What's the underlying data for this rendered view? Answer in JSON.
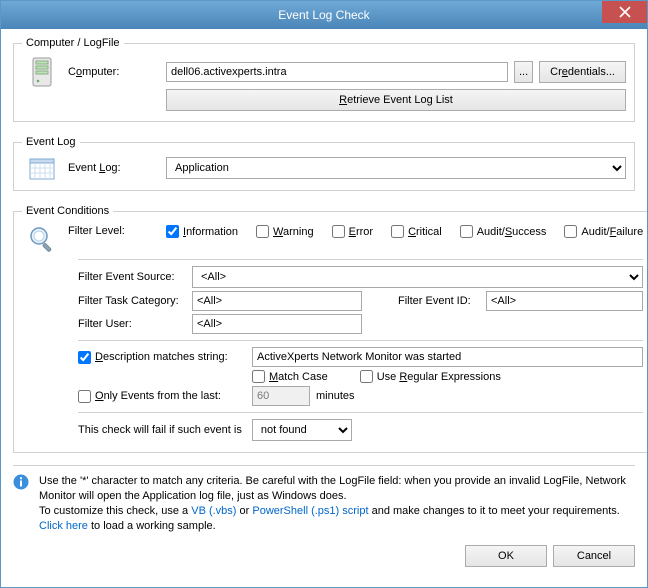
{
  "title": "Event Log Check",
  "groups": {
    "computer": "Computer / LogFile",
    "eventlog": "Event Log",
    "conditions": "Event Conditions"
  },
  "computer": {
    "label_pre": "C",
    "label_u": "o",
    "label_post": "mputer:",
    "value": "dell06.activexperts.intra",
    "browse": "...",
    "credentials_pre": "Cr",
    "credentials_u": "e",
    "credentials_post": "dentials...",
    "retrieve_pre": "",
    "retrieve_u": "R",
    "retrieve_post": "etrieve Event Log List"
  },
  "eventlog": {
    "label_pre": "Event ",
    "label_u": "L",
    "label_post": "og:",
    "value": "Application"
  },
  "conditions": {
    "filter_level": "Filter Level:",
    "levels": {
      "information_u": "I",
      "information_post": "nformation",
      "warning_u": "W",
      "warning_post": "arning",
      "error_u": "E",
      "error_post": "rror",
      "critical_u": "C",
      "critical_post": "ritical",
      "audit_success_pre": "Audit/",
      "audit_success_u": "S",
      "audit_success_post": "uccess",
      "audit_failure_pre": "Audit/",
      "audit_failure_u": "F",
      "audit_failure_post": "ailure"
    },
    "source_label": "Filter Event Source:",
    "source_value": "<All>",
    "task_label": "Filter Task Category:",
    "task_value": "<All>",
    "eventid_label": "Filter Event ID:",
    "eventid_value": "<All>",
    "user_label": "Filter User:",
    "user_value": "<All>",
    "desc_pre": "",
    "desc_u": "D",
    "desc_post": "escription matches string:",
    "desc_value": "ActiveXperts Network Monitor was started",
    "matchcase_u": "M",
    "matchcase_post": "atch Case",
    "regex_pre": "Use ",
    "regex_u": "R",
    "regex_post": "egular Expressions",
    "only_pre": "",
    "only_u": "O",
    "only_post": "nly Events from the last:",
    "only_value": "60",
    "only_unit": "minutes",
    "fail_label": "This check will fail if such event is",
    "fail_value": "not found"
  },
  "info": {
    "l1": "Use the '*' character to match any criteria. Be careful with the LogFile field: when you provide an invalid LogFile, Network Monitor will open the Application log file, just as Windows does.",
    "l2a": "To customize this check, use a ",
    "vb": "VB (.vbs)",
    "l2b": "   or ",
    "ps": "PowerShell (.ps1) script",
    "l2c": " and make changes to it to meet your requirements.",
    "l3a": "Click here",
    "l3b": " to load a working sample."
  },
  "footer": {
    "ok": "OK",
    "cancel": "Cancel"
  }
}
